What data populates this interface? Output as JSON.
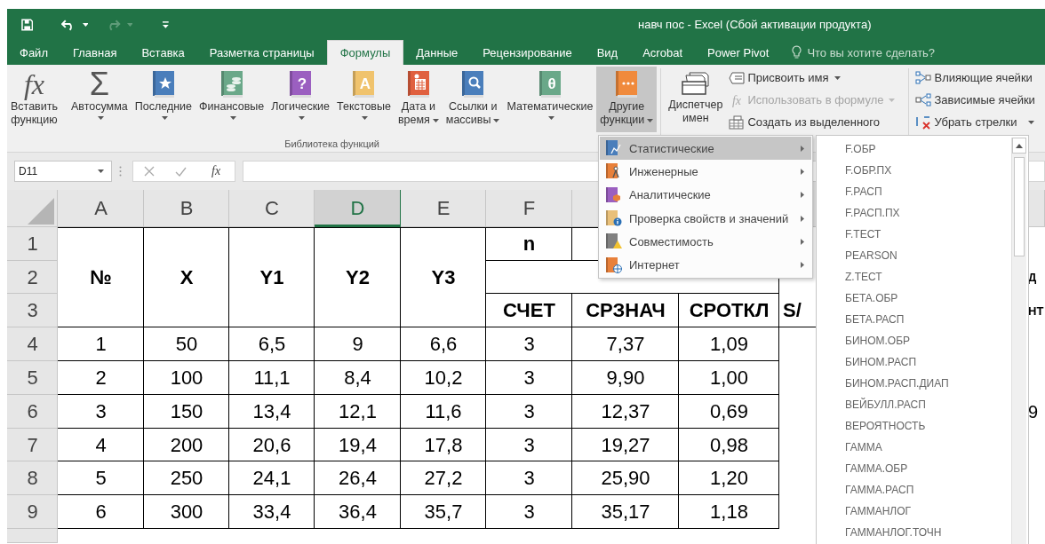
{
  "title": "навч пос - Excel (Сбой активации продукта)",
  "tabs": [
    {
      "label": "Файл",
      "selected": false
    },
    {
      "label": "Главная",
      "selected": false
    },
    {
      "label": "Вставка",
      "selected": false
    },
    {
      "label": "Разметка страницы",
      "selected": false
    },
    {
      "label": "Формулы",
      "selected": true
    },
    {
      "label": "Данные",
      "selected": false
    },
    {
      "label": "Рецензирование",
      "selected": false
    },
    {
      "label": "Вид",
      "selected": false
    },
    {
      "label": "Acrobat",
      "selected": false
    },
    {
      "label": "Power Pivot",
      "selected": false
    }
  ],
  "tell_me": {
    "placeholder": "Что вы хотите сделать?"
  },
  "ribbon": {
    "buttons": [
      {
        "label": "Вставить\nфункцию",
        "glyph": "fx",
        "pressed": false
      },
      {
        "label": "Автосумма",
        "glyph": "Σ",
        "pressed": false
      },
      {
        "label": "Последние",
        "pressed": false
      },
      {
        "label": "Финансовые",
        "pressed": false
      },
      {
        "label": "Логические",
        "glyph": "?",
        "pressed": false
      },
      {
        "label": "Текстовые",
        "glyph": "A",
        "pressed": false
      },
      {
        "label": "Дата и\nвремя",
        "pressed": false
      },
      {
        "label": "Ссылки и\nмассивы",
        "pressed": false
      },
      {
        "label": "Математические",
        "glyph": "θ",
        "pressed": false
      },
      {
        "label": "Другие\nфункции",
        "pressed": true
      }
    ],
    "group_label": "Библиотека функций",
    "name_manager": {
      "label": "Диспетчер\nимен"
    },
    "name_commands": [
      {
        "label": "Присвоить имя",
        "disabled": false
      },
      {
        "label": "Использовать в формуле",
        "glyph": "fx",
        "disabled": true
      },
      {
        "label": "Создать из выделенного",
        "disabled": false
      }
    ],
    "audit_commands": [
      {
        "label": "Влияющие ячейки"
      },
      {
        "label": "Зависимые ячейки"
      },
      {
        "label": "Убрать стрелки"
      }
    ]
  },
  "formula_bar": {
    "name_box": "D11",
    "insert_function": "fx"
  },
  "sheet": {
    "columns": [
      {
        "label": "A",
        "selected": false
      },
      {
        "label": "B",
        "selected": false
      },
      {
        "label": "C",
        "selected": false
      },
      {
        "label": "D",
        "selected": true
      },
      {
        "label": "E",
        "selected": false
      },
      {
        "label": "F",
        "selected": false
      }
    ],
    "row_headers": [
      "1",
      "2",
      "3",
      "4",
      "5",
      "6",
      "7",
      "8",
      "9"
    ],
    "titles": [
      "№",
      "X",
      "Y1",
      "Y2",
      "Y3"
    ],
    "n_label": "n",
    "stats": [
      "СЧЕТ",
      "СРЗНАЧ",
      "СРОТКЛ",
      "S/"
    ],
    "edge_header": [
      "Д",
      "НТ"
    ],
    "rows": [
      {
        "cells": [
          "1",
          "50",
          "6,5",
          "9",
          "6,6",
          "3",
          "7,37",
          "1,09"
        ]
      },
      {
        "cells": [
          "2",
          "100",
          "11,1",
          "8,4",
          "10,2",
          "3",
          "9,90",
          "1,00"
        ]
      },
      {
        "cells": [
          "3",
          "150",
          "13,4",
          "12,1",
          "11,6",
          "3",
          "12,37",
          "0,69"
        ],
        "edge": "9"
      },
      {
        "cells": [
          "4",
          "200",
          "20,6",
          "19,4",
          "17,8",
          "3",
          "19,27",
          "0,98"
        ]
      },
      {
        "cells": [
          "5",
          "250",
          "24,1",
          "26,4",
          "27,2",
          "3",
          "25,90",
          "1,20"
        ]
      },
      {
        "cells": [
          "6",
          "300",
          "33,4",
          "36,4",
          "35,7",
          "3",
          "35,17",
          "1,18"
        ]
      }
    ]
  },
  "function_menu": {
    "items": [
      {
        "label": "Статистические",
        "selected": true
      },
      {
        "label": "Инженерные",
        "selected": false
      },
      {
        "label": "Аналитические",
        "selected": false
      },
      {
        "label": "Проверка свойств и значений",
        "selected": false
      },
      {
        "label": "Совместимость",
        "selected": false
      },
      {
        "label": "Интернет",
        "selected": false
      }
    ]
  },
  "function_list": {
    "items": [
      "F.ОБР",
      "F.ОБР.ПХ",
      "F.РАСП",
      "F.РАСП.ПХ",
      "F.ТЕСТ",
      "PEARSON",
      "Z.ТЕСТ",
      "БЕТА.ОБР",
      "БЕТА.РАСП",
      "БИНОМ.ОБР",
      "БИНОМ.РАСП",
      "БИНОМ.РАСП.ДИАП",
      "ВЕЙБУЛЛ.РАСП",
      "ВЕРОЯТНОСТЬ",
      "ГАММА",
      "ГАММА.ОБР",
      "ГАММА.РАСП",
      "ГАММАНЛОГ",
      "ГАММАНЛОГ.ТОЧН"
    ]
  }
}
